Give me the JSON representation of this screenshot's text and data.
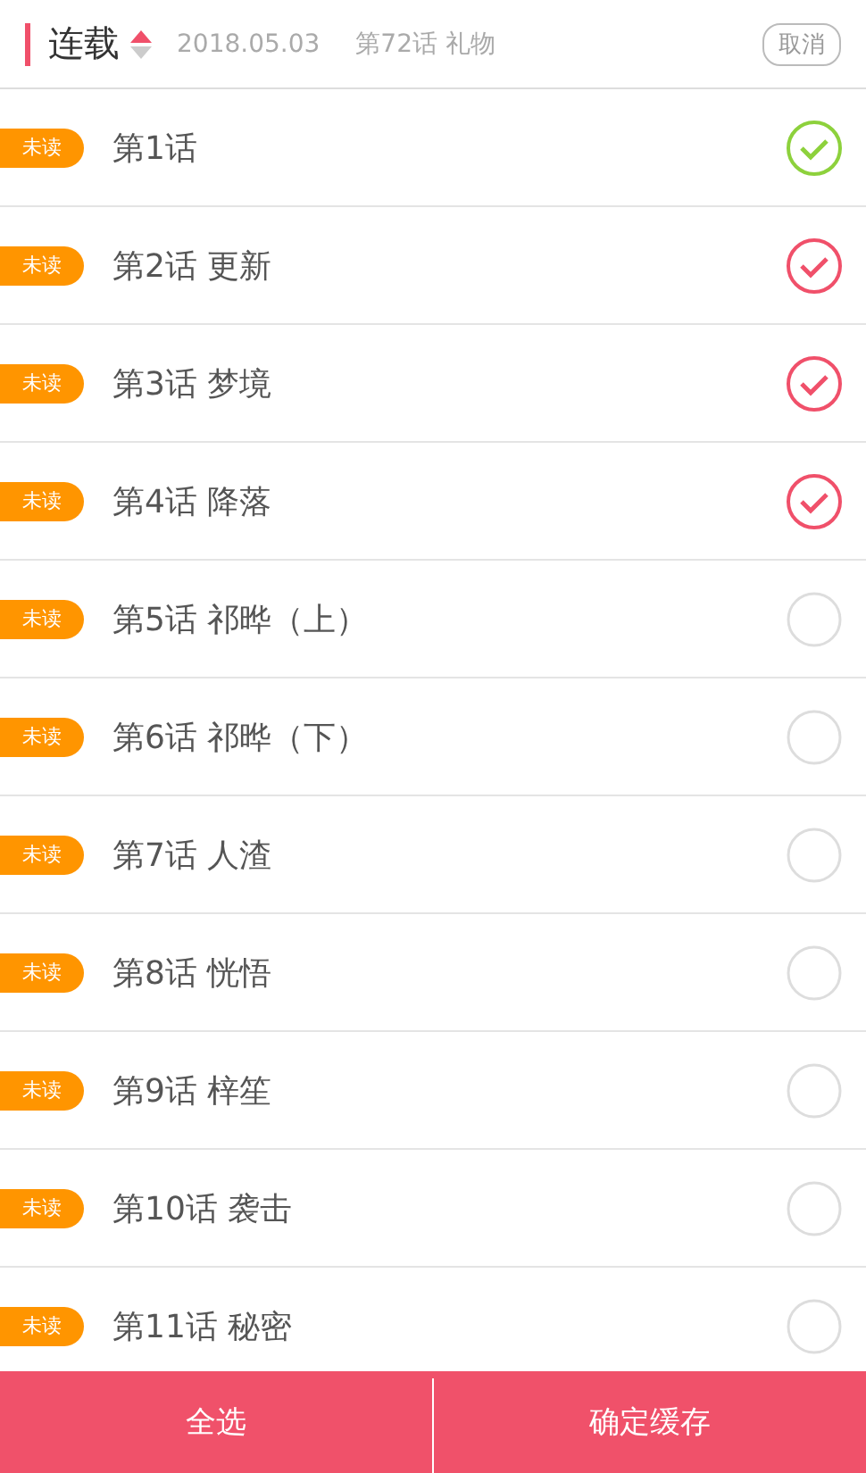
{
  "header": {
    "title": "连载",
    "date": "2018.05.03",
    "latest": "第72话 礼物",
    "cancel": "取消"
  },
  "chapters": [
    {
      "badge": "未读",
      "title": "第1话",
      "downloaded": true,
      "selected": false
    },
    {
      "badge": "未读",
      "title": "第2话 更新",
      "downloaded": false,
      "selected": true
    },
    {
      "badge": "未读",
      "title": "第3话 梦境",
      "downloaded": false,
      "selected": true
    },
    {
      "badge": "未读",
      "title": "第4话 降落",
      "downloaded": false,
      "selected": true
    },
    {
      "badge": "未读",
      "title": "第5话 祁晔（上）",
      "downloaded": false,
      "selected": false
    },
    {
      "badge": "未读",
      "title": "第6话 祁晔（下）",
      "downloaded": false,
      "selected": false
    },
    {
      "badge": "未读",
      "title": "第7话 人渣",
      "downloaded": false,
      "selected": false
    },
    {
      "badge": "未读",
      "title": "第8话 恍悟",
      "downloaded": false,
      "selected": false
    },
    {
      "badge": "未读",
      "title": "第9话 梓笙",
      "downloaded": false,
      "selected": false
    },
    {
      "badge": "未读",
      "title": "第10话 袭击",
      "downloaded": false,
      "selected": false
    },
    {
      "badge": "未读",
      "title": "第11话 秘密",
      "downloaded": false,
      "selected": false
    }
  ],
  "footer": {
    "select_all": "全选",
    "confirm": "确定缓存"
  }
}
